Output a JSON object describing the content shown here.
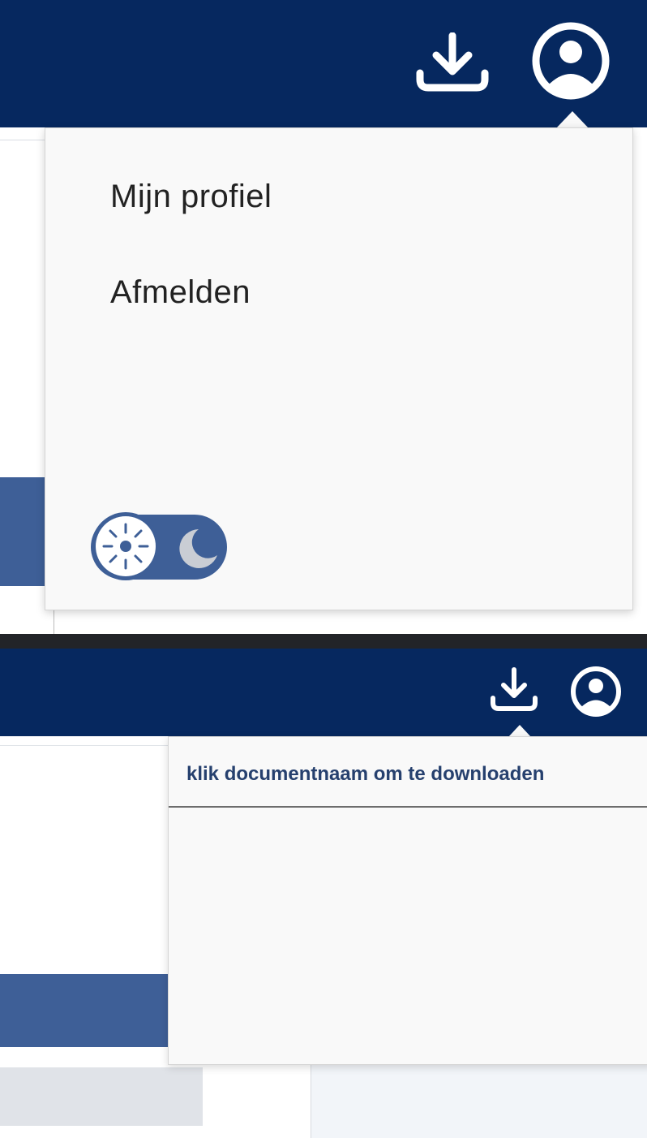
{
  "top_panel": {
    "header": {
      "download_icon": "download-icon",
      "user_icon": "user-circle-icon"
    },
    "profile_menu": {
      "items": [
        {
          "label": "Mijn profiel"
        },
        {
          "label": "Afmelden"
        }
      ],
      "theme_toggle": {
        "state": "light",
        "light_icon": "sun-icon",
        "dark_icon": "moon-icon"
      }
    }
  },
  "bottom_panel": {
    "header": {
      "download_icon": "download-icon",
      "user_icon": "user-circle-icon"
    },
    "download_menu": {
      "hint": "klik documentnaam om te downloaden"
    }
  },
  "colors": {
    "header_bg": "#06285f",
    "accent_blue": "#3e5f97",
    "menu_bg": "#f9f9f9",
    "hint_text": "#26406e"
  }
}
